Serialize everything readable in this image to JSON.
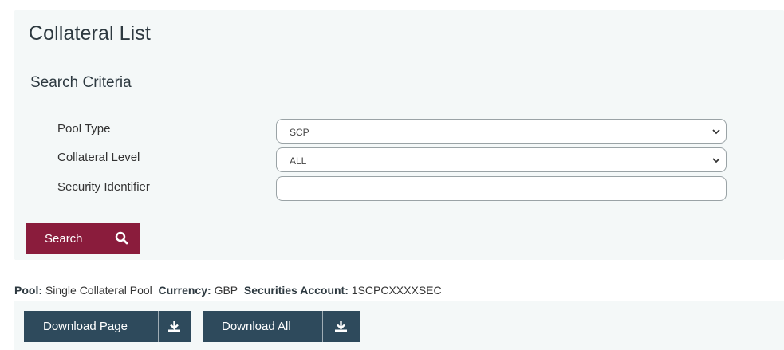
{
  "page": {
    "title": "Collateral List"
  },
  "search": {
    "section_title": "Search Criteria",
    "pool_type": {
      "label": "Pool Type",
      "value": "SCP"
    },
    "collateral_level": {
      "label": "Collateral Level",
      "value": "ALL"
    },
    "security_identifier": {
      "label": "Security Identifier",
      "value": "",
      "placeholder": ""
    },
    "button_label": "Search"
  },
  "pool_info": {
    "pool_label": "Pool:",
    "pool_value": "Single Collateral Pool",
    "currency_label": "Currency:",
    "currency_value": "GBP",
    "account_label": "Securities Account:",
    "account_value": "1SCPCXXXXSEC"
  },
  "downloads": {
    "page_label": "Download Page",
    "all_label": "Download All"
  },
  "icons": {
    "search": "search-icon",
    "download": "download-icon",
    "chevron": "chevron-down-icon"
  },
  "colors": {
    "search_button": "#8a1c3c",
    "download_button": "#2e4a5c",
    "panel_bg": "#f4f8f8"
  }
}
